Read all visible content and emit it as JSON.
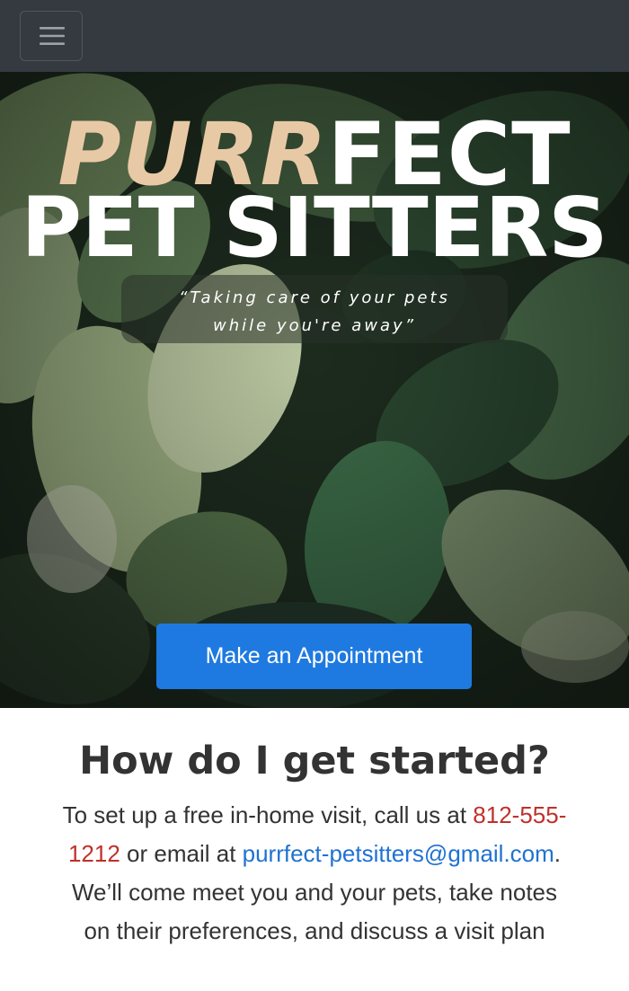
{
  "nav": {
    "toggle_icon": "hamburger-menu-icon"
  },
  "hero": {
    "title_accent": "PURR",
    "title_rest": "FECT",
    "title_line2": "PET SITTERS",
    "tagline_line1": "“Taking care of your pets",
    "tagline_line2": "while you're away”",
    "cta_label": "Make an Appointment"
  },
  "started": {
    "heading": "How do I get started?",
    "text_before_phone": "To set up a free in-home visit, call us at ",
    "phone": "812-555-1212",
    "text_before_email": " or email at ",
    "email": "purrfect-petsitters@gmail.com",
    "text_after_email": ". We’ll come meet you and your pets, take notes on their preferences, and discuss a visit plan"
  },
  "colors": {
    "navbar": "#343a40",
    "accent": "#e8c9a6",
    "button": "#1e7ae0",
    "phone_link": "#c0302a",
    "email_link": "#1f72d1"
  }
}
